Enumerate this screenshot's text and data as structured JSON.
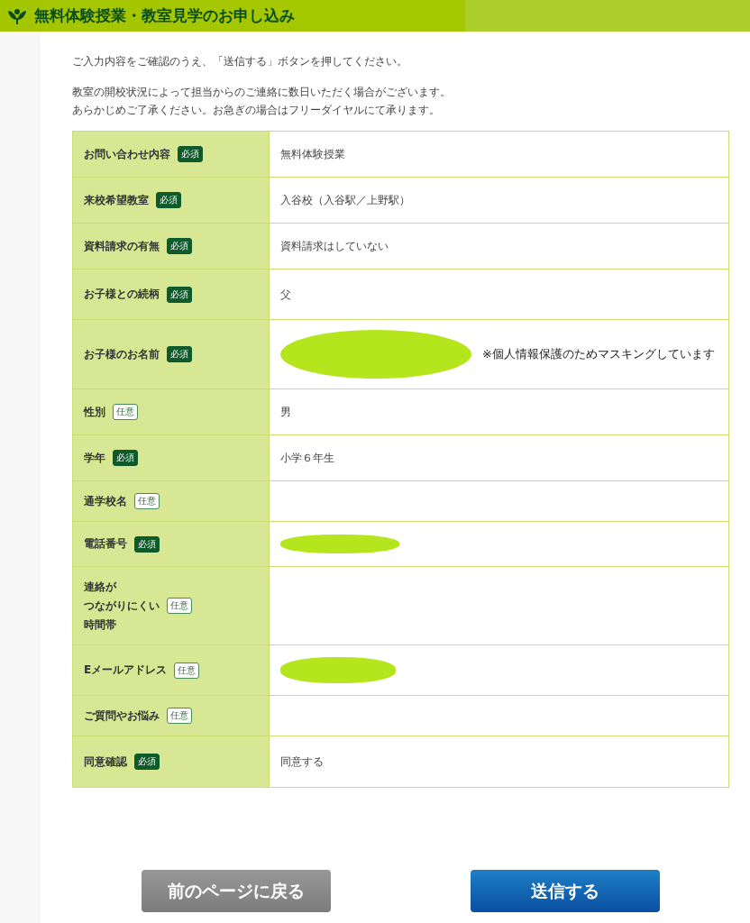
{
  "header": {
    "title": "無料体験授業・教室見学のお申し込み"
  },
  "intro": [
    {
      "lines": [
        "ご入力内容をご確認のうえ、「送信する」ボタンを押してください。"
      ]
    },
    {
      "lines": [
        "教室の開校状況によって担当からのご連絡に数日いただく場合がございます。",
        "あらかじめご了承ください。お急ぎの場合はフリーダイヤルにて承ります。"
      ]
    }
  ],
  "rows": [
    {
      "label": [
        "お問い合わせ内容"
      ],
      "badge": {
        "text": "必須",
        "required": true
      },
      "kind": "text",
      "value": "無料体験授業"
    },
    {
      "label": [
        "来校希望教室"
      ],
      "badge": {
        "text": "必須",
        "required": true
      },
      "kind": "text",
      "value": "入谷校（入谷駅／上野駅）"
    },
    {
      "label": [
        "資料請求の有無"
      ],
      "badge": {
        "text": "必須",
        "required": true
      },
      "kind": "text",
      "value": "資料請求はしていない"
    },
    {
      "label": [
        "お子様との続柄"
      ],
      "badge": {
        "text": "必須",
        "required": true
      },
      "kind": "text",
      "value": "父"
    },
    {
      "label": [
        "お子様のお名前"
      ],
      "badge": {
        "text": "必須",
        "required": true
      },
      "kind": "masked",
      "note": "※個人情報保護のためマスキングしています"
    },
    {
      "label": [
        "性別"
      ],
      "badge": {
        "text": "任意",
        "required": false
      },
      "kind": "text",
      "value": "男"
    },
    {
      "label": [
        "学年"
      ],
      "badge": {
        "text": "必須",
        "required": true
      },
      "kind": "text",
      "value": "小学６年生"
    },
    {
      "label": [
        "通学校名"
      ],
      "badge": {
        "text": "任意",
        "required": false
      },
      "kind": "empty"
    },
    {
      "label": [
        "電話番号"
      ],
      "badge": {
        "text": "必須",
        "required": true
      },
      "kind": "masked"
    },
    {
      "label": [
        "連絡が",
        "つながりにくい",
        "時間帯"
      ],
      "badge": {
        "text": "任意",
        "required": false
      },
      "kind": "empty"
    },
    {
      "label": [
        "Eメールアドレス"
      ],
      "badge": {
        "text": "任意",
        "required": false
      },
      "kind": "masked"
    },
    {
      "label": [
        "ご質問やお悩み"
      ],
      "badge": {
        "text": "任意",
        "required": false
      },
      "kind": "empty"
    },
    {
      "label": [
        "同意確認"
      ],
      "badge": {
        "text": "必須",
        "required": true
      },
      "kind": "text",
      "value": "同意する"
    }
  ],
  "buttons": [
    {
      "label": "前のページに戻る",
      "kind": "back"
    },
    {
      "label": "送信する",
      "kind": "submit"
    }
  ]
}
